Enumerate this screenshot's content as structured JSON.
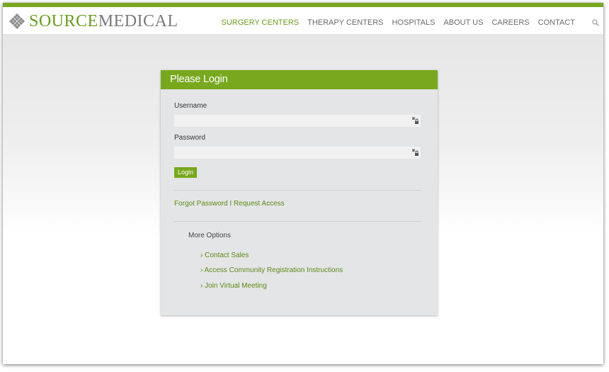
{
  "brand": {
    "logo_part1": "SOURCE",
    "logo_part2": "MEDICAL",
    "accent_color": "#78a81e"
  },
  "nav": {
    "items": [
      {
        "label": "SURGERY CENTERS",
        "active": true
      },
      {
        "label": "THERAPY CENTERS",
        "active": false
      },
      {
        "label": "HOSPITALS",
        "active": false
      },
      {
        "label": "ABOUT US",
        "active": false
      },
      {
        "label": "CAREERS",
        "active": false
      },
      {
        "label": "CONTACT",
        "active": false
      }
    ],
    "search_icon": "search-icon"
  },
  "login": {
    "title": "Please Login",
    "username_label": "Username",
    "username_value": "",
    "password_label": "Password",
    "password_value": "",
    "field_icon": "key-icon",
    "login_button": "Login",
    "forgot_password": "Forgot Password",
    "separator": "I",
    "request_access": "Request Access",
    "more_options_title": "More Options",
    "options": [
      "› Contact Sales",
      "› Access Community Registration Instructions",
      "› Join Virtual Meeting"
    ]
  }
}
